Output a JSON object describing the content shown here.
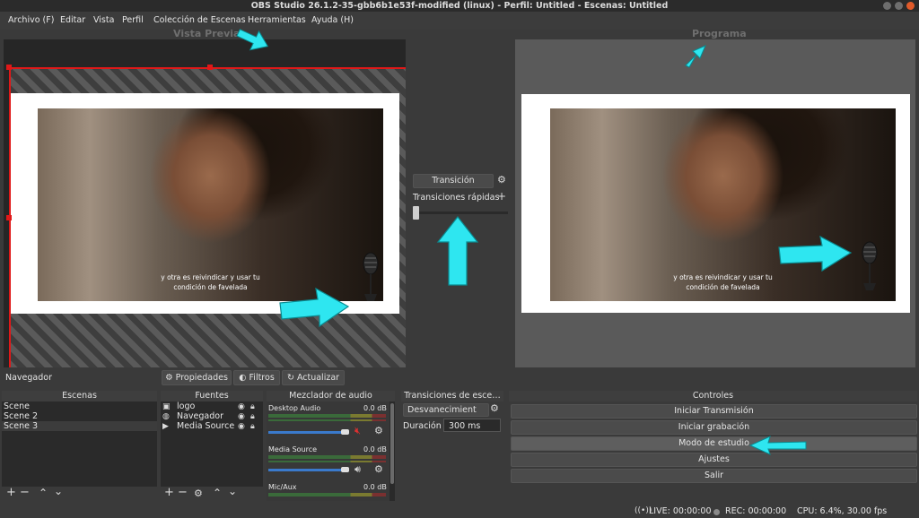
{
  "window": {
    "title": "OBS Studio 26.1.2-35-gbb6b1e53f-modified (linux) - Perfil: Untitled - Escenas: Untitled"
  },
  "menu": [
    "Archivo (F)",
    "Editar",
    "Vista",
    "Perfil",
    "Colección de Escenas",
    "Herramientas",
    "Ayuda (H)"
  ],
  "preview": {
    "title": "Vista Previa",
    "caption_line1": "y otra es reivindicar y usar tu",
    "caption_line2": "condición de favelada"
  },
  "program": {
    "title": "Programa",
    "caption_line1": "y otra es reivindicar y usar tu",
    "caption_line2": "condición de favelada"
  },
  "transition": {
    "button": "Transición",
    "quick": "Transiciones rápidas"
  },
  "source_toolbar": {
    "selected": "Navegador",
    "properties": "Propiedades",
    "filters": "Filtros",
    "refresh": "Actualizar"
  },
  "scenes": {
    "title": "Escenas",
    "items": [
      "Scene",
      "Scene 2",
      "Scene 3"
    ]
  },
  "sources": {
    "title": "Fuentes",
    "items": [
      "logo",
      "Navegador",
      "Media Source"
    ]
  },
  "mixer": {
    "title": "Mezclador de audio",
    "channels": [
      {
        "name": "Desktop Audio",
        "db": "0.0 dB",
        "muted": true
      },
      {
        "name": "Media Source",
        "db": "0.0 dB",
        "muted": false
      },
      {
        "name": "Mic/Aux",
        "db": "0.0 dB",
        "muted": false
      }
    ]
  },
  "scene_transitions": {
    "title": "Transiciones de esce…",
    "selected": "Desvanecimient",
    "duration_label": "Duración",
    "duration_value": "300 ms"
  },
  "controls": {
    "title": "Controles",
    "buttons": [
      "Iniciar Transmisión",
      "Iniciar grabación",
      "Modo de estudio",
      "Ajustes",
      "Salir"
    ]
  },
  "status": {
    "live": "LIVE: 00:00:00",
    "rec": "REC: 00:00:00",
    "cpu": "CPU: 6.4%, 30.00 fps"
  },
  "colors": {
    "annotation_arrow": "#2ee6f0",
    "selection_box": "#e01818",
    "accent": "#3a7acc"
  }
}
